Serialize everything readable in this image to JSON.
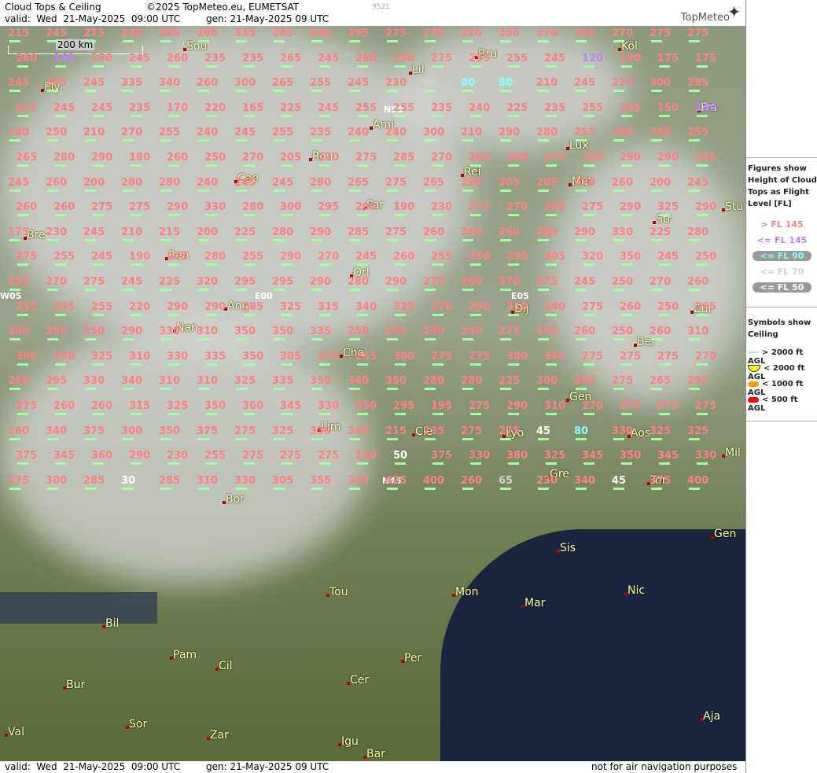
{
  "header": {
    "title": "Cloud Tops & Ceiling",
    "copyright": "©2025 TopMeteo.eu, EUMETSAT",
    "valid": "valid:  Wed  21-May-2025  09:00 UTC",
    "gen": "gen: 21-May-2025 09 UTC",
    "code": "9521",
    "logo": "TopMeteo"
  },
  "footer": {
    "valid": "valid:  Wed  21-May-2025  09:00 UTC",
    "gen": "gen: 21-May-2025 09 UTC",
    "note": "not for air navigation purposes"
  },
  "scale": "200 km",
  "legend": {
    "figures_title": "Figures show Height of Cloud Tops as Flight Level  [FL]",
    "fl_rows": [
      {
        "label": "> FL 145",
        "color": "#ff8080"
      },
      {
        "label": "<= FL 145",
        "color": "#c080ff"
      },
      {
        "label": "<= FL 90",
        "color": "#80ffff"
      },
      {
        "label": "<= FL 70",
        "color": "#d0d0d0"
      },
      {
        "label": "<= FL 50",
        "color": "#ffffff"
      }
    ],
    "ceiling_title": "Symbols show Ceiling",
    "ceil_rows": [
      {
        "label": "> 2000 ft AGL",
        "color": "#a0ffa0"
      },
      {
        "label": "< 2000 ft AGL",
        "color": "#ffff00"
      },
      {
        "label": "< 1000 ft AGL",
        "color": "#ff9900"
      },
      {
        "label": "< 500 ft AGL",
        "color": "#ff0000"
      }
    ]
  },
  "cities": [
    {
      "name": "Sou"
    },
    {
      "name": "Lil"
    },
    {
      "name": "Bru"
    },
    {
      "name": "Köl"
    },
    {
      "name": "Ply"
    },
    {
      "name": "Ami"
    },
    {
      "name": "Fra"
    },
    {
      "name": "Lux"
    },
    {
      "name": "Rou"
    },
    {
      "name": "Rei"
    },
    {
      "name": "Cae"
    },
    {
      "name": "Met"
    },
    {
      "name": "Par"
    },
    {
      "name": "Str"
    },
    {
      "name": "Stu"
    },
    {
      "name": "Bre"
    },
    {
      "name": "Ren"
    },
    {
      "name": "Orl"
    },
    {
      "name": "Ang"
    },
    {
      "name": "Dij"
    },
    {
      "name": "Zür"
    },
    {
      "name": "Nan"
    },
    {
      "name": "Ber"
    },
    {
      "name": "Cha"
    },
    {
      "name": "Gen"
    },
    {
      "name": "Lim"
    },
    {
      "name": "Cle"
    },
    {
      "name": "Lyo"
    },
    {
      "name": "Aos"
    },
    {
      "name": "Mil"
    },
    {
      "name": "Gre"
    },
    {
      "name": "Tor"
    },
    {
      "name": "Bor"
    },
    {
      "name": "Gen"
    },
    {
      "name": "Sis"
    },
    {
      "name": "Tou"
    },
    {
      "name": "Mon"
    },
    {
      "name": "Mar"
    },
    {
      "name": "Nic"
    },
    {
      "name": "Bil"
    },
    {
      "name": "Pam"
    },
    {
      "name": "Cil"
    },
    {
      "name": "Per"
    },
    {
      "name": "Cer"
    },
    {
      "name": "Bur"
    },
    {
      "name": "Sor"
    },
    {
      "name": "Val"
    },
    {
      "name": "Zar"
    },
    {
      "name": "Igu"
    },
    {
      "name": "Bar"
    },
    {
      "name": "Aja"
    }
  ],
  "grid_labels": [
    "N50",
    "W05",
    "E00",
    "E05",
    "N45"
  ],
  "fl_values": [
    "215",
    "245",
    "275",
    "245",
    "245",
    "260",
    "335",
    "265",
    "240",
    "295",
    "275",
    "275",
    "220",
    "250",
    "270",
    "260",
    "270",
    "275",
    "275",
    "260",
    "140",
    "230",
    "245",
    "260",
    "235",
    "235",
    "265",
    "245",
    "280",
    "250",
    "275",
    "255",
    "255",
    "245",
    "120",
    "190",
    "175",
    "175",
    "245",
    "345",
    "245",
    "335",
    "340",
    "260",
    "300",
    "265",
    "255",
    "245",
    "230",
    "60",
    "80",
    "80",
    "210",
    "245",
    "270",
    "300",
    "285",
    "215",
    "245",
    "245",
    "235",
    "170",
    "220",
    "165",
    "225",
    "245",
    "255",
    "255",
    "235",
    "240",
    "225",
    "235",
    "255",
    "245",
    "150",
    "140",
    "180",
    "250",
    "210",
    "270",
    "255",
    "240",
    "245",
    "255",
    "235",
    "240",
    "240",
    "300",
    "210",
    "290",
    "280",
    "255",
    "280",
    "260",
    "255",
    "265",
    "280",
    "290",
    "180",
    "260",
    "250",
    "270",
    "205",
    "190",
    "275",
    "285",
    "270",
    "260",
    "260",
    "270",
    "285",
    "290",
    "290",
    "255",
    "245",
    "260",
    "200",
    "280",
    "280",
    "240",
    "245",
    "245",
    "280",
    "265",
    "275",
    "265",
    "290",
    "305",
    "205",
    "270",
    "260",
    "200",
    "245",
    "260",
    "260",
    "275",
    "275",
    "290",
    "330",
    "280",
    "300",
    "295",
    "200",
    "190",
    "230",
    "275",
    "270",
    "260",
    "275",
    "290",
    "325",
    "290",
    "175",
    "230",
    "245",
    "210",
    "215",
    "200",
    "225",
    "280",
    "290",
    "285",
    "275",
    "260",
    "260",
    "260",
    "290",
    "290",
    "330",
    "225",
    "280",
    "275",
    "255",
    "245",
    "190",
    "245",
    "280",
    "255",
    "290",
    "270",
    "245",
    "260",
    "255",
    "250",
    "290",
    "305",
    "320",
    "350",
    "245",
    "250",
    "225",
    "270",
    "275",
    "245",
    "225",
    "320",
    "295",
    "295",
    "290",
    "280",
    "290",
    "275",
    "260",
    "270",
    "275",
    "245",
    "250",
    "270",
    "260",
    "255",
    "255",
    "255",
    "220",
    "290",
    "290",
    "285",
    "325",
    "315",
    "340",
    "325",
    "270",
    "290",
    "310",
    "240",
    "275",
    "260",
    "250",
    "265",
    "280",
    "290",
    "250",
    "290",
    "330",
    "310",
    "350",
    "350",
    "335",
    "250",
    "290",
    "290",
    "250",
    "275",
    "265",
    "260",
    "250",
    "260",
    "310",
    "300",
    "290",
    "325",
    "310",
    "330",
    "335",
    "350",
    "305",
    "275",
    "265",
    "300",
    "275",
    "275",
    "300",
    "350",
    "275",
    "275",
    "275",
    "270",
    "260",
    "295",
    "330",
    "340",
    "310",
    "310",
    "325",
    "335",
    "350",
    "340",
    "350",
    "280",
    "280",
    "225",
    "300",
    "290",
    "275",
    "265",
    "255",
    "275",
    "260",
    "260",
    "315",
    "325",
    "350",
    "360",
    "345",
    "330",
    "350",
    "295",
    "195",
    "275",
    "290",
    "310",
    "270",
    "270",
    "275",
    "275",
    "260",
    "340",
    "375",
    "300",
    "350",
    "375",
    "275",
    "325",
    "330",
    "345",
    "215",
    "235",
    "275",
    "275",
    "45",
    "80",
    "330",
    "325",
    "325",
    "375",
    "345",
    "360",
    "290",
    "230",
    "255",
    "275",
    "275",
    "275",
    "160",
    "50",
    "375",
    "330",
    "380",
    "325",
    "345",
    "350",
    "345",
    "330",
    "275",
    "300",
    "285",
    "30",
    "285",
    "310",
    "330",
    "305",
    "355",
    "350",
    "425",
    "400",
    "260",
    "65",
    "230",
    "340",
    "45",
    "375",
    "400"
  ]
}
